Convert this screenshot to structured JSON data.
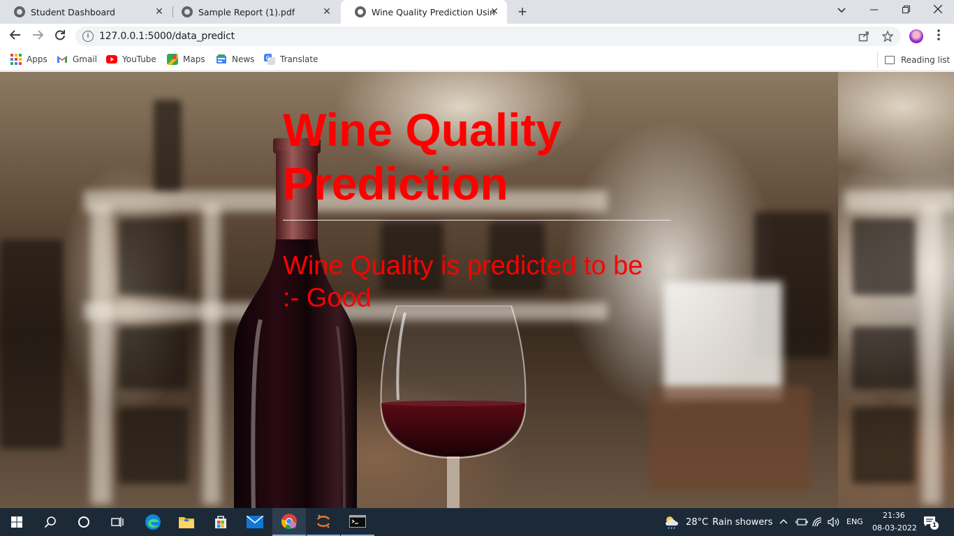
{
  "browser": {
    "tabs": [
      {
        "title": "Student Dashboard",
        "active": false
      },
      {
        "title": "Sample Report (1).pdf",
        "active": false
      },
      {
        "title": "Wine Quality Prediction Using M",
        "active": true
      }
    ],
    "close_glyph": "✕",
    "new_tab_glyph": "+",
    "url": "127.0.0.1:5000/data_predict",
    "bookmarks": [
      "Apps",
      "Gmail",
      "YouTube",
      "Maps",
      "News",
      "Translate"
    ],
    "reading_list": "Reading list"
  },
  "page": {
    "heading": "Wine Quality Prediction",
    "result": "Wine Quality is predicted to be :- Good"
  },
  "taskbar": {
    "weather_temp": "28°C",
    "weather_desc": "Rain showers",
    "lang": "ENG",
    "time": "21:36",
    "date": "08-03-2022",
    "notif_count": "1"
  },
  "colors": {
    "heading_red": "#ff0000",
    "taskbar_bg": "#1c2a38",
    "tab_strip": "#dee1e6"
  }
}
